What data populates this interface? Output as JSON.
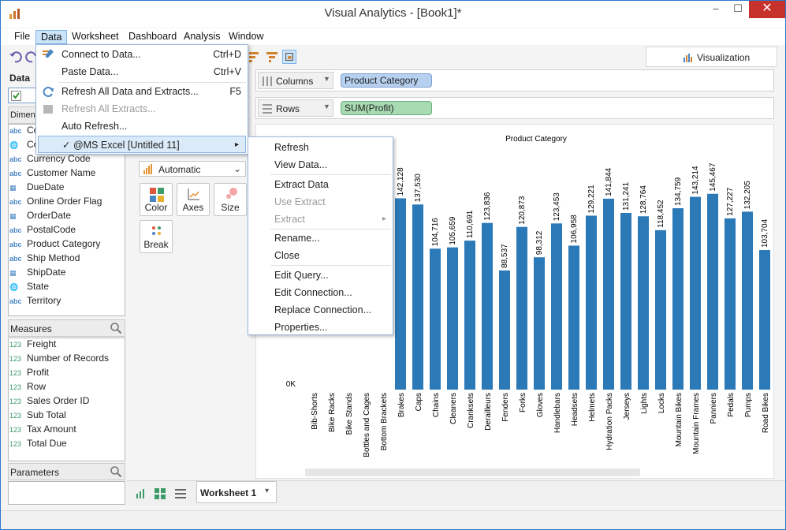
{
  "window": {
    "title": "Visual Analytics - [Book1]*",
    "minimize": "–",
    "maximize": "☐",
    "close": "✕"
  },
  "menubar": [
    "File",
    "Data",
    "Worksheet",
    "Dashboard",
    "Analysis",
    "Window"
  ],
  "visualization_tab": "Visualization",
  "left_panel": {
    "data_header": "Data",
    "dimensions_header": "Dimensions",
    "dimensions": [
      {
        "type": "abc",
        "label": "Color"
      },
      {
        "type": "geo",
        "label": "Country"
      },
      {
        "type": "abc",
        "label": "Currency Code"
      },
      {
        "type": "abc",
        "label": "Customer Name"
      },
      {
        "type": "date",
        "label": "DueDate"
      },
      {
        "type": "abc",
        "label": "Online Order Flag"
      },
      {
        "type": "date",
        "label": "OrderDate"
      },
      {
        "type": "abc",
        "label": "PostalCode"
      },
      {
        "type": "abc",
        "label": "Product Category"
      },
      {
        "type": "abc",
        "label": "Ship Method"
      },
      {
        "type": "date",
        "label": "ShipDate"
      },
      {
        "type": "geo",
        "label": "State"
      },
      {
        "type": "abc",
        "label": "Territory"
      }
    ],
    "measures_header": "Measures",
    "measures": [
      {
        "type": "123",
        "label": "Freight"
      },
      {
        "type": "123",
        "label": "Number of Records"
      },
      {
        "type": "123",
        "label": "Profit"
      },
      {
        "type": "123",
        "label": "Row"
      },
      {
        "type": "123",
        "label": "Sales Order ID"
      },
      {
        "type": "123",
        "label": "Sub Total"
      },
      {
        "type": "123",
        "label": "Tax Amount"
      },
      {
        "type": "123",
        "label": "Total Due"
      }
    ],
    "parameters_header": "Parameters"
  },
  "shelves": {
    "columns_label": "Columns",
    "columns_pill": "Product Category",
    "rows_label": "Rows",
    "rows_pill": "SUM(Profit)"
  },
  "marks": {
    "type": "Automatic",
    "buttons": [
      "Color",
      "Axes",
      "Size",
      "Break"
    ]
  },
  "data_menu": {
    "items": [
      {
        "label": "Connect to Data...",
        "shortcut": "Ctrl+D",
        "disabled": false
      },
      {
        "label": "Paste Data...",
        "shortcut": "Ctrl+V",
        "disabled": false
      },
      {
        "label": "Refresh All Data and Extracts...",
        "shortcut": "F5",
        "disabled": false
      },
      {
        "label": "Refresh All Extracts...",
        "shortcut": "",
        "disabled": true
      },
      {
        "label": "Auto Refresh...",
        "shortcut": "",
        "disabled": false
      },
      {
        "label": "✓ @MS Excel [Untitled 11]",
        "shortcut": "▸",
        "disabled": false
      }
    ]
  },
  "submenu": {
    "items": [
      {
        "label": "Refresh",
        "disabled": false
      },
      {
        "label": "View Data...",
        "disabled": false
      },
      {
        "label": "Extract Data",
        "disabled": false
      },
      {
        "label": "Use Extract",
        "disabled": true
      },
      {
        "label": "Extract",
        "disabled": true
      },
      {
        "label": "Rename...",
        "disabled": false
      },
      {
        "label": "Close",
        "disabled": false
      },
      {
        "label": "Edit Query...",
        "disabled": false
      },
      {
        "label": "Edit Connection...",
        "disabled": false
      },
      {
        "label": "Replace Connection...",
        "disabled": false
      },
      {
        "label": "Properties...",
        "disabled": false
      }
    ],
    "extract_arrow": "▸"
  },
  "worksheet_tab": "Worksheet 1",
  "worksheet_tab_arrow": "▾",
  "chart_data": {
    "type": "bar",
    "title": "Product Category",
    "color": "#2c79b8",
    "y_tick": "0K",
    "categories": [
      "Bib-Shorts",
      "Bike Racks",
      "Bike Stands",
      "Bottles and Cages",
      "Bottom Brackets",
      "Brakes",
      "Caps",
      "Chains",
      "Cleaners",
      "Cranksets",
      "Derailleurs",
      "Fenders",
      "Forks",
      "Gloves",
      "Handlebars",
      "Headsets",
      "Helmets",
      "Hydration Packs",
      "Jerseys",
      "Lights",
      "Locks",
      "Mountain Bikes",
      "Mountain Frames",
      "Panniers",
      "Pedals",
      "Pumps",
      "Road Bikes"
    ],
    "values": [
      null,
      null,
      null,
      null,
      null,
      142128,
      137530,
      104716,
      105659,
      110691,
      123836,
      88537,
      120873,
      98312,
      123453,
      106958,
      129221,
      141844,
      131241,
      128764,
      118452,
      134759,
      143214,
      145467,
      127227,
      132205,
      103704
    ],
    "labels": [
      "",
      "",
      "",
      "",
      "",
      "142,128",
      "137,530",
      "104,716",
      "105,659",
      "110,691",
      "123,836",
      "88,537",
      "120,873",
      "98,312",
      "123,453",
      "106,958",
      "129,221",
      "141,844",
      "131,241",
      "128,764",
      "118,452",
      "134,759",
      "143,214",
      "145,467",
      "127,227",
      "132,205",
      "103,704"
    ]
  }
}
